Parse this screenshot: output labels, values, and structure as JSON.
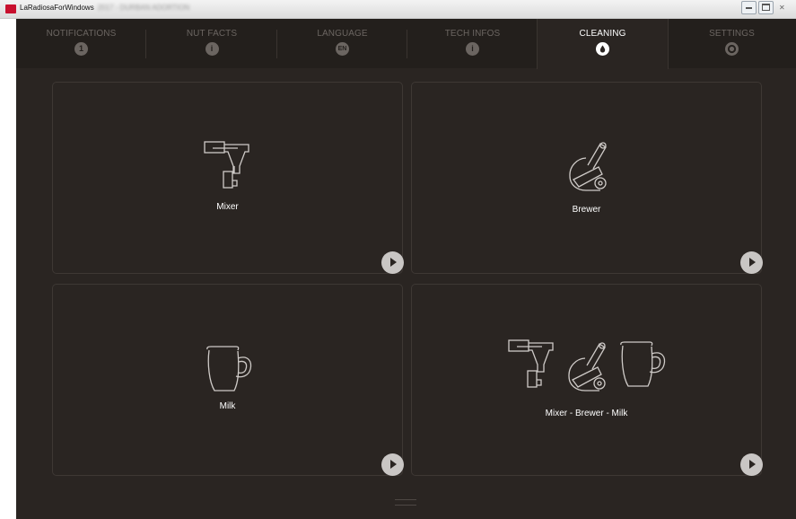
{
  "window": {
    "title": "LaRadiosaForWindows",
    "title_extra": "2017 - DURBAN ADORTION",
    "app_icon": "laradiosa-logo",
    "brand_color": "#c8102e"
  },
  "tabs": [
    {
      "label": "NOTIFICATIONS",
      "badge": "1"
    },
    {
      "label": "NUT FACTS",
      "badge": "i"
    },
    {
      "label": "LANGUAGE",
      "badge": "EN"
    },
    {
      "label": "TECH INFOS",
      "badge": "i"
    },
    {
      "label": "CLEANING",
      "badge": "●",
      "active": true
    },
    {
      "label": "SETTINGS",
      "badge": "⚙"
    }
  ],
  "cards": [
    {
      "label": "Mixer",
      "icon": "mixer-icon"
    },
    {
      "label": "Brewer",
      "icon": "brewer-icon"
    },
    {
      "label": "Milk",
      "icon": "milk-jug-icon"
    },
    {
      "label": "Mixer - Brewer - Milk",
      "icon": "mixer-brewer-milk-icons"
    }
  ],
  "colors": {
    "background": "#2a2522",
    "tab_bar": "#231f1c",
    "inactive_text": "#6b6561",
    "active_text": "#ffffff",
    "play_button": "#c9c6c4"
  }
}
